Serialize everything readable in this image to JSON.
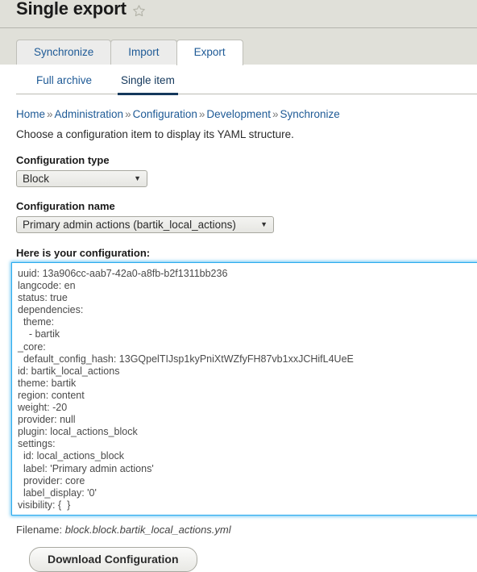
{
  "header": {
    "title": "Single export",
    "star_icon": "star-outline-icon"
  },
  "primary_tabs": [
    {
      "label": "Synchronize",
      "active": false
    },
    {
      "label": "Import",
      "active": false
    },
    {
      "label": "Export",
      "active": true
    }
  ],
  "secondary_tabs": [
    {
      "label": "Full archive",
      "active": false
    },
    {
      "label": "Single item",
      "active": true
    }
  ],
  "breadcrumb": {
    "items": [
      "Home",
      "Administration",
      "Configuration",
      "Development",
      "Synchronize"
    ],
    "separator": "»"
  },
  "intro_text": "Choose a configuration item to display its YAML structure.",
  "form": {
    "configuration_type": {
      "label": "Configuration type",
      "value": "Block",
      "caret_icon": "chevron-down-icon"
    },
    "configuration_name": {
      "label": "Configuration name",
      "value": "Primary admin actions (bartik_local_actions)",
      "caret_icon": "chevron-down-icon"
    },
    "configuration_output": {
      "label": "Here is your configuration:",
      "value": "uuid: 13a906cc-aab7-42a0-a8fb-b2f1311bb236\nlangcode: en\nstatus: true\ndependencies:\n  theme:\n    - bartik\n_core:\n  default_config_hash: 13GQpelTIJsp1kyPniXtWZfyFH87vb1xxJCHifL4UeE\nid: bartik_local_actions\ntheme: bartik\nregion: content\nweight: -20\nprovider: null\nplugin: local_actions_block\nsettings:\n  id: local_actions_block\n  label: 'Primary admin actions'\n  provider: core\n  label_display: '0'\nvisibility: {  }"
    }
  },
  "footer": {
    "filename_label": "Filename:",
    "filename": "block.block.bartik_local_actions.yml",
    "download_button": "Download Configuration"
  },
  "colors": {
    "header_band": "#e0e0d9",
    "link": "#1e5a96",
    "active_tab_underline": "#14385c",
    "focus_ring": "#2aabee"
  }
}
